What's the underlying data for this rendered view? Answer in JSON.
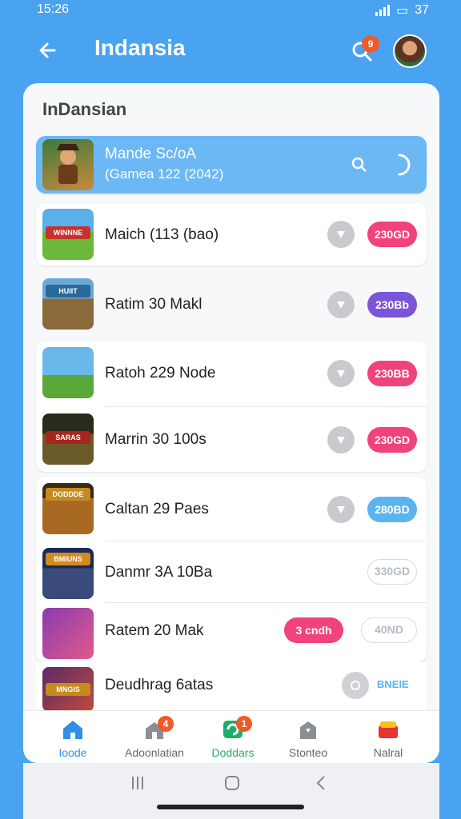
{
  "status": {
    "time": "15:26",
    "battery": "37"
  },
  "header": {
    "title": "Indansia",
    "notification_count": "9"
  },
  "section": {
    "title": "InDansian"
  },
  "highlight_item": {
    "title": "Mande Sc/oA",
    "subtitle": "(Gamea 122 (2042)"
  },
  "items": [
    {
      "title": "Maich (113 (bao)",
      "badge": "230GD",
      "badge_color": "#f0437a",
      "thumb_label": "WINNNE",
      "thumb_color": "#e8b832"
    },
    {
      "title": "Ratim 30 Makl",
      "badge": "230Bb",
      "badge_color": "#7a55d8",
      "thumb_label": "HUIIT",
      "thumb_color": "#3a4d7a"
    },
    {
      "title": "Ratoh 229 Node",
      "badge": "230BB",
      "badge_color": "#f0437a",
      "thumb_label": "",
      "thumb_color": "#5fa6d8"
    },
    {
      "title": "Marrin 30 100s",
      "badge": "230GD",
      "badge_color": "#f0437a",
      "thumb_label": "SARAS",
      "thumb_color": "#3b3a28"
    },
    {
      "title": "Caltan 29 Paes",
      "badge": "280BD",
      "badge_color": "#5ab4f0",
      "thumb_label": "DODDDE",
      "thumb_color": "#8a5a22"
    },
    {
      "title": "Danmr 3A 10Ba",
      "badge": "330GD",
      "badge_color": "",
      "thumb_label": "BMIUNS",
      "thumb_color": "#2a3a6a"
    },
    {
      "title": "Ratem 20 Mak",
      "badge": "40ND",
      "badge_color": "",
      "action": "3 cndh",
      "action_color": "#f0437a",
      "thumb_label": "",
      "thumb_color": "#8a3ab0"
    },
    {
      "title": "Deudhrag 6atas",
      "badge": "BNEIE",
      "badge_color": "",
      "thumb_label": "MNGIS",
      "thumb_color": "#5a2a6a"
    }
  ],
  "tabs": [
    {
      "label": "Ioode",
      "badge": "",
      "color": "#2f8ee8",
      "icon": "home-icon"
    },
    {
      "label": "Adoonlatian",
      "badge": "4",
      "color": "#666666",
      "icon": "building-icon"
    },
    {
      "label": "Doddars",
      "badge": "1",
      "color": "#1bae6a",
      "icon": "wallet-icon"
    },
    {
      "label": "Stonteo",
      "badge": "",
      "color": "#666666",
      "icon": "store-icon"
    },
    {
      "label": "Nalral",
      "badge": "",
      "color": "#666666",
      "icon": "gift-icon"
    }
  ]
}
